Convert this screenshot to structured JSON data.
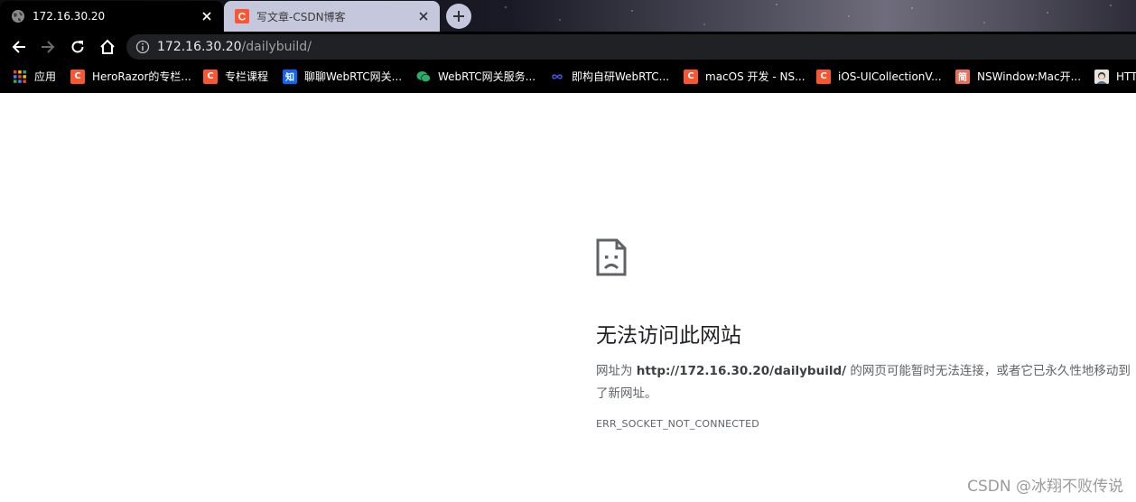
{
  "tabs": [
    {
      "title": "172.16.30.20",
      "active": true,
      "icon": "globe-icon"
    },
    {
      "title": "写文章-CSDN博客",
      "active": false,
      "icon": "csdn-icon"
    }
  ],
  "toolbar": {
    "url_host": "172.16.30.20",
    "url_path": "/dailybuild/"
  },
  "bookmarks": [
    {
      "label": "应用",
      "icon": "apps-grid-icon"
    },
    {
      "label": "HeroRazor的专栏...",
      "icon": "csdn-icon"
    },
    {
      "label": "专栏课程",
      "icon": "csdn-icon"
    },
    {
      "label": "聊聊WebRTC网关...",
      "icon": "zhihu-icon"
    },
    {
      "label": "WebRTC网关服务...",
      "icon": "wechat-icon"
    },
    {
      "label": "即构自研WebRTC...",
      "icon": "infinity-icon"
    },
    {
      "label": "macOS 开发 - NS...",
      "icon": "csdn-icon"
    },
    {
      "label": "iOS-UICollectionV...",
      "icon": "csdn-icon"
    },
    {
      "label": "NSWindow:Mac开...",
      "icon": "jianshu-icon"
    },
    {
      "label": "HTT",
      "icon": "avatar-icon"
    }
  ],
  "error": {
    "title": "无法访问此网站",
    "desc_prefix": "网址为 ",
    "desc_url": "http://172.16.30.20/dailybuild/",
    "desc_suffix": " 的网页可能暂时无法连接，或者它已永久性地移动到了新网址。",
    "code": "ERR_SOCKET_NOT_CONNECTED"
  },
  "watermark": "CSDN @冰翔不败传说",
  "colors": {
    "csdn_red": "#fc5531",
    "zhihu_blue": "#0a66ff",
    "wechat_green": "#2aae67",
    "jianshu_red": "#ea6f5a"
  }
}
